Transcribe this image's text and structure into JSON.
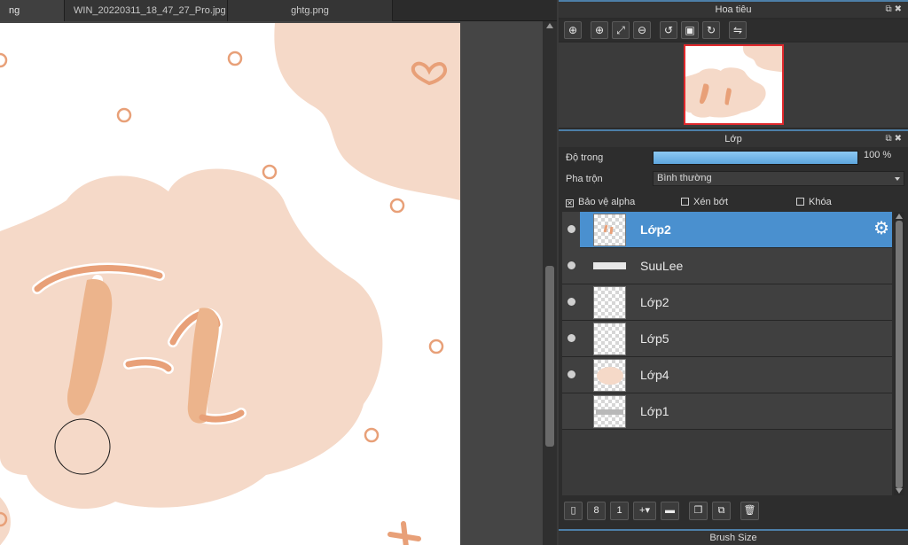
{
  "tabs": [
    {
      "label": "ng"
    },
    {
      "label": "WIN_20220311_18_47_27_Pro.jpg"
    },
    {
      "label": "ghtg.png"
    }
  ],
  "navigator": {
    "title": "Hoa tiêu",
    "tools": [
      {
        "icon": "zoom-fit-icon",
        "glyph": "⊕"
      },
      {
        "icon": "zoom-in-icon",
        "glyph": "⊕"
      },
      {
        "icon": "fit-screen-icon",
        "glyph": "⤢"
      },
      {
        "icon": "zoom-out-icon",
        "glyph": "⊖"
      },
      {
        "icon": "rotate-left-icon",
        "glyph": "↺"
      },
      {
        "icon": "fit-window-icon",
        "glyph": "▣"
      },
      {
        "icon": "rotate-right-icon",
        "glyph": "↻"
      },
      {
        "icon": "flip-icon",
        "glyph": "⇋"
      }
    ]
  },
  "layers_panel": {
    "title": "Lớp",
    "opacity_label": "Độ trong",
    "opacity_value": "100 %",
    "opacity_fraction": 1.0,
    "blend_label": "Pha trộn",
    "blend_value": "Bình thường",
    "protect_alpha_label": "Bảo vệ alpha",
    "protect_alpha_checked": true,
    "clipping_label": "Xén bớt",
    "clipping_checked": false,
    "lock_label": "Khóa",
    "lock_checked": false,
    "layers": [
      {
        "name": "Lớp2",
        "selected": true,
        "visible": true
      },
      {
        "name": "SuuLee",
        "selected": false,
        "visible": true
      },
      {
        "name": "Lớp2",
        "selected": false,
        "visible": true
      },
      {
        "name": "Lớp5",
        "selected": false,
        "visible": true
      },
      {
        "name": "Lớp4",
        "selected": false,
        "visible": true
      },
      {
        "name": "Lớp1",
        "selected": false,
        "visible": false
      }
    ],
    "toolbar": [
      {
        "icon": "new-layer-icon",
        "glyph": "▯"
      },
      {
        "icon": "new-8bit-layer-icon",
        "glyph": "8"
      },
      {
        "icon": "new-1bit-layer-icon",
        "glyph": "1"
      },
      {
        "icon": "add-layer-menu-icon",
        "glyph": "+▾"
      },
      {
        "icon": "new-folder-icon",
        "glyph": "▬"
      },
      {
        "icon": "duplicate-layer-icon",
        "glyph": "❐"
      },
      {
        "icon": "merge-down-icon",
        "glyph": "⧉"
      },
      {
        "icon": "delete-layer-icon",
        "glyph": "🗑"
      }
    ]
  },
  "brush_size": {
    "title": "Brush Size"
  },
  "colors": {
    "accent": "#4a90cf",
    "artwork_peach": "#f5d9c8",
    "artwork_orange": "#e8a078",
    "nav_frame": "#e0282c"
  }
}
